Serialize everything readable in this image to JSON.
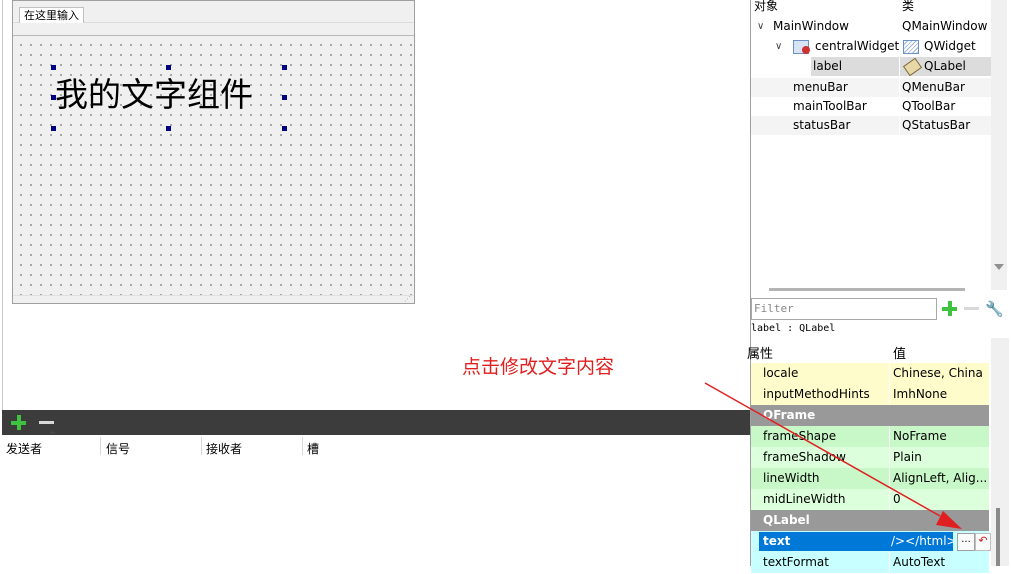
{
  "form": {
    "menu_item": "在这里输入",
    "label_text": "我的文字组件"
  },
  "annotation": {
    "text": "点击修改文字内容",
    "color": "#e02020"
  },
  "signal_editor": {
    "columns": [
      "发送者",
      "信号",
      "接收者",
      "槽"
    ]
  },
  "object_inspector": {
    "header": {
      "object": "对象",
      "class": "类"
    },
    "rows": [
      {
        "name": "MainWindow",
        "class": "QMainWindow"
      },
      {
        "name": "centralWidget",
        "class": "QWidget"
      },
      {
        "name": "label",
        "class": "QLabel"
      },
      {
        "name": "menuBar",
        "class": "QMenuBar"
      },
      {
        "name": "mainToolBar",
        "class": "QToolBar"
      },
      {
        "name": "statusBar",
        "class": "QStatusBar"
      }
    ]
  },
  "property_editor": {
    "filter_placeholder": "Filter",
    "object_label": "label : QLabel",
    "header": {
      "property": "属性",
      "value": "值"
    },
    "rows": [
      {
        "name": "locale",
        "value": "Chinese, China"
      },
      {
        "name": "inputMethodHints",
        "value": "ImhNone"
      },
      {
        "group": "QFrame"
      },
      {
        "name": "frameShape",
        "value": "NoFrame"
      },
      {
        "name": "frameShadow",
        "value": "Plain"
      },
      {
        "name": "lineWidth",
        "value": "AlignLeft, Alig..."
      },
      {
        "name": "midLineWidth",
        "value": "0"
      },
      {
        "group": "QLabel"
      },
      {
        "name": "text",
        "value": "/></html>"
      },
      {
        "name": "textFormat",
        "value": "AutoText"
      }
    ],
    "ellipsis_label": "...",
    "reset_label": "↶"
  },
  "colors": {
    "selection": "#0078d7",
    "group_header": "#999999",
    "signal_toolbar": "#3c3c3c",
    "handle": "#000080"
  }
}
